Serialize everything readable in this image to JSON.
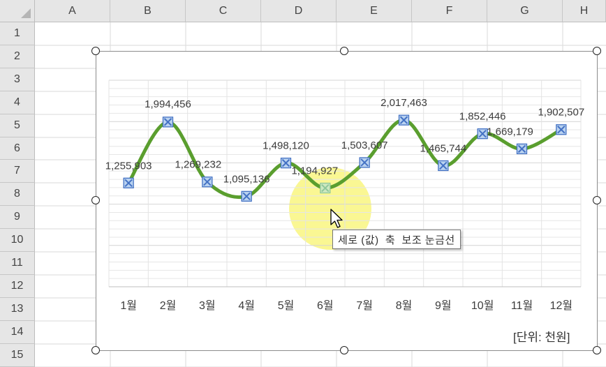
{
  "columns": [
    "A",
    "B",
    "C",
    "D",
    "E",
    "F",
    "G",
    "H"
  ],
  "rows": [
    "1",
    "2",
    "3",
    "4",
    "5",
    "6",
    "7",
    "8",
    "9",
    "10",
    "11",
    "12",
    "13",
    "14",
    "15"
  ],
  "chart_data": {
    "type": "line",
    "categories": [
      "1월",
      "2월",
      "3월",
      "4월",
      "5월",
      "6월",
      "7월",
      "8월",
      "9월",
      "10월",
      "11월",
      "12월"
    ],
    "values": [
      1255903,
      1994456,
      1269232,
      1095136,
      1498120,
      1194927,
      1503607,
      2017463,
      1465744,
      1852446,
      1669179,
      1902507
    ],
    "data_labels": [
      "1,255,903",
      "1,994,456",
      "1,269,232",
      "1,095,136",
      "1,498,120",
      "1,194,927",
      "1,503,607",
      "2,017,463",
      "1,465,744",
      "1,852,446",
      "1,669,179",
      "1,902,507"
    ],
    "title": "",
    "xlabel": "",
    "ylabel": "",
    "ylim": [
      0,
      2500000
    ],
    "smooth": true,
    "line_color": "#5a9e2e",
    "marker_color": "#4472c4",
    "selected_marker": "6월",
    "grid": "minor horizontal + vertical",
    "unit_note": "[단위: 천원]"
  },
  "tooltip": {
    "text": "세로 (값)  축  보조 눈금선"
  },
  "highlight_color": "#f5f03a"
}
